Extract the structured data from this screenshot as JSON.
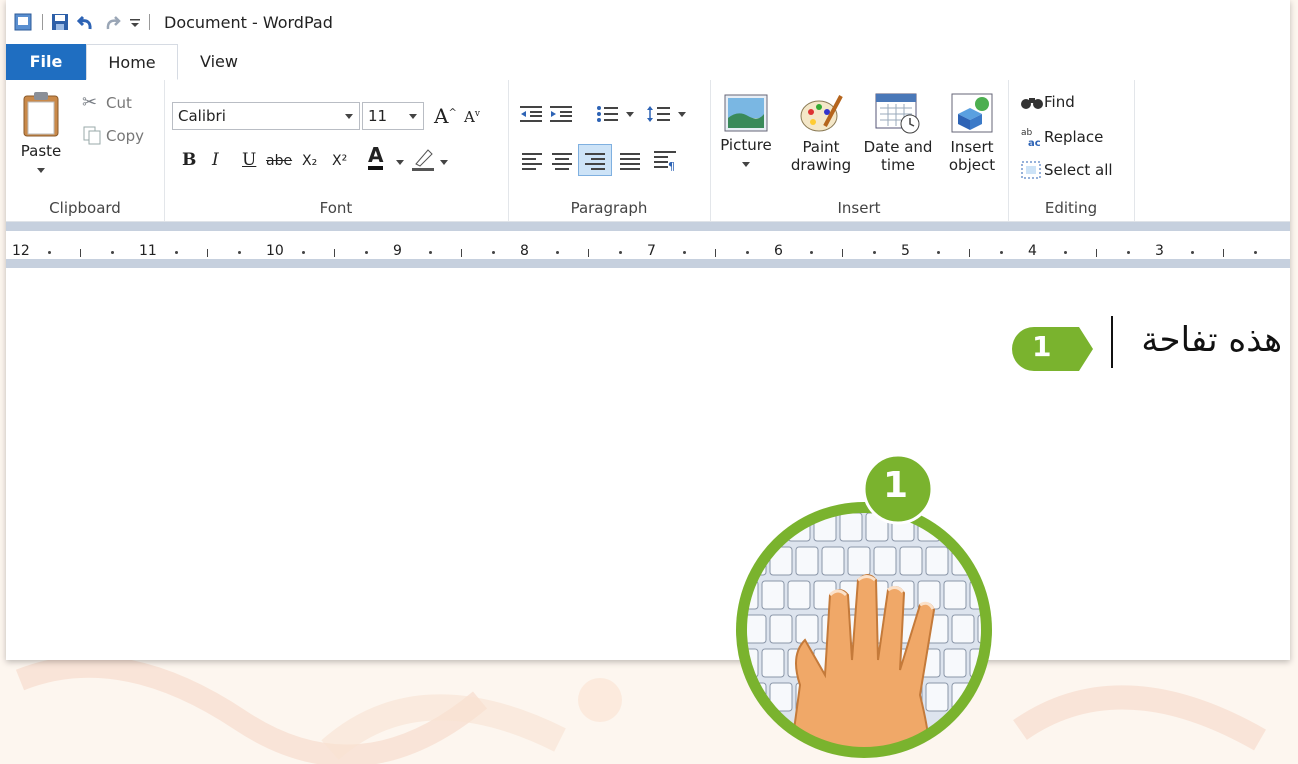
{
  "window": {
    "title": "Document - WordPad"
  },
  "tabs": [
    {
      "label": "File"
    },
    {
      "label": "Home"
    },
    {
      "label": "View"
    }
  ],
  "clipboard": {
    "paste_label": "Paste",
    "cut_label": "Cut",
    "copy_label": "Copy",
    "group_label": "Clipboard"
  },
  "font": {
    "family": "Calibri",
    "size": "11",
    "bold": "B",
    "italic": "I",
    "underline": "U",
    "strike": "abe",
    "subscript": "X₂",
    "superscript": "X²",
    "font_color": "A",
    "group_label": "Font"
  },
  "paragraph": {
    "group_label": "Paragraph"
  },
  "insert": {
    "picture_label": "Picture",
    "paint_label_1": "Paint",
    "paint_label_2": "drawing",
    "datetime_label_1": "Date and",
    "datetime_label_2": "time",
    "object_label_1": "Insert",
    "object_label_2": "object",
    "group_label": "Insert"
  },
  "editing": {
    "find_label": "Find",
    "replace_label": "Replace",
    "selectall_label": "Select all",
    "group_label": "Editing"
  },
  "ruler": {
    "numbers": [
      "12",
      "11",
      "10",
      "9",
      "8",
      "7",
      "6",
      "5",
      "4",
      "3"
    ]
  },
  "document": {
    "text": "هذه تفاحة"
  },
  "callouts": {
    "step_text": "1",
    "keyboard_step": "1"
  },
  "colors": {
    "accent_green": "#7ab32e",
    "file_tab_blue": "#1f6ec1"
  }
}
